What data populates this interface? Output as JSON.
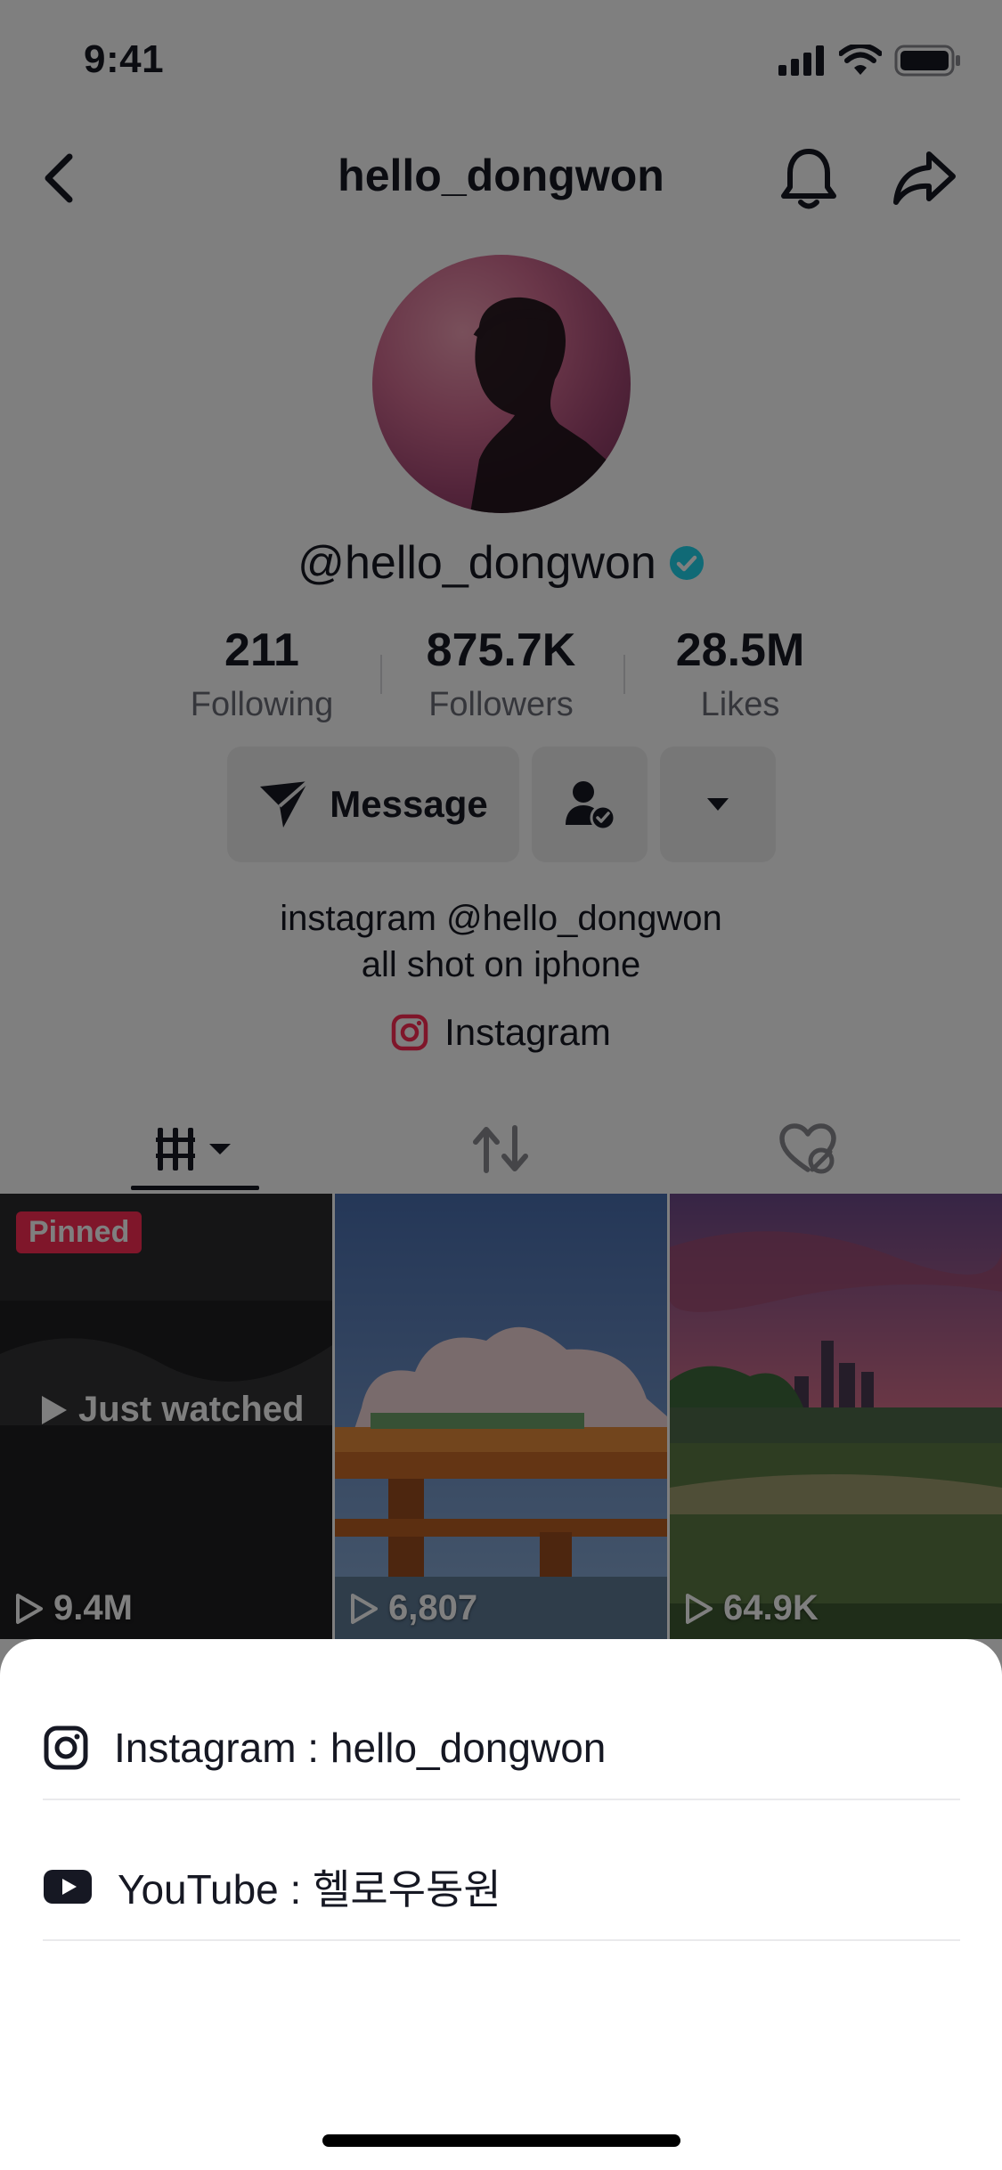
{
  "status_bar": {
    "time": "9:41"
  },
  "nav": {
    "title": "hello_dongwon"
  },
  "profile": {
    "handle": "@hello_dongwon",
    "stats": [
      {
        "value": "211",
        "label": "Following"
      },
      {
        "value": "875.7K",
        "label": "Followers"
      },
      {
        "value": "28.5M",
        "label": "Likes"
      }
    ],
    "message_label": "Message",
    "bio_line1": "instagram @hello_dongwon",
    "bio_line2": "all shot on iphone",
    "link_label": "Instagram"
  },
  "grid": {
    "videos": [
      {
        "badge": "Pinned",
        "overlay": "Just watched",
        "views": "9.4M"
      },
      {
        "views": "6,807"
      },
      {
        "views": "64.9K"
      }
    ]
  },
  "sheet": {
    "items": [
      {
        "label": "Instagram : hello_dongwon",
        "icon": "instagram-icon"
      },
      {
        "label": "YouTube : 헬로우동원",
        "icon": "youtube-icon"
      }
    ]
  },
  "colors": {
    "accent": "#fe2c55",
    "verified": "#20d5ec",
    "text": "#161823",
    "muted": "#6b6d76"
  }
}
